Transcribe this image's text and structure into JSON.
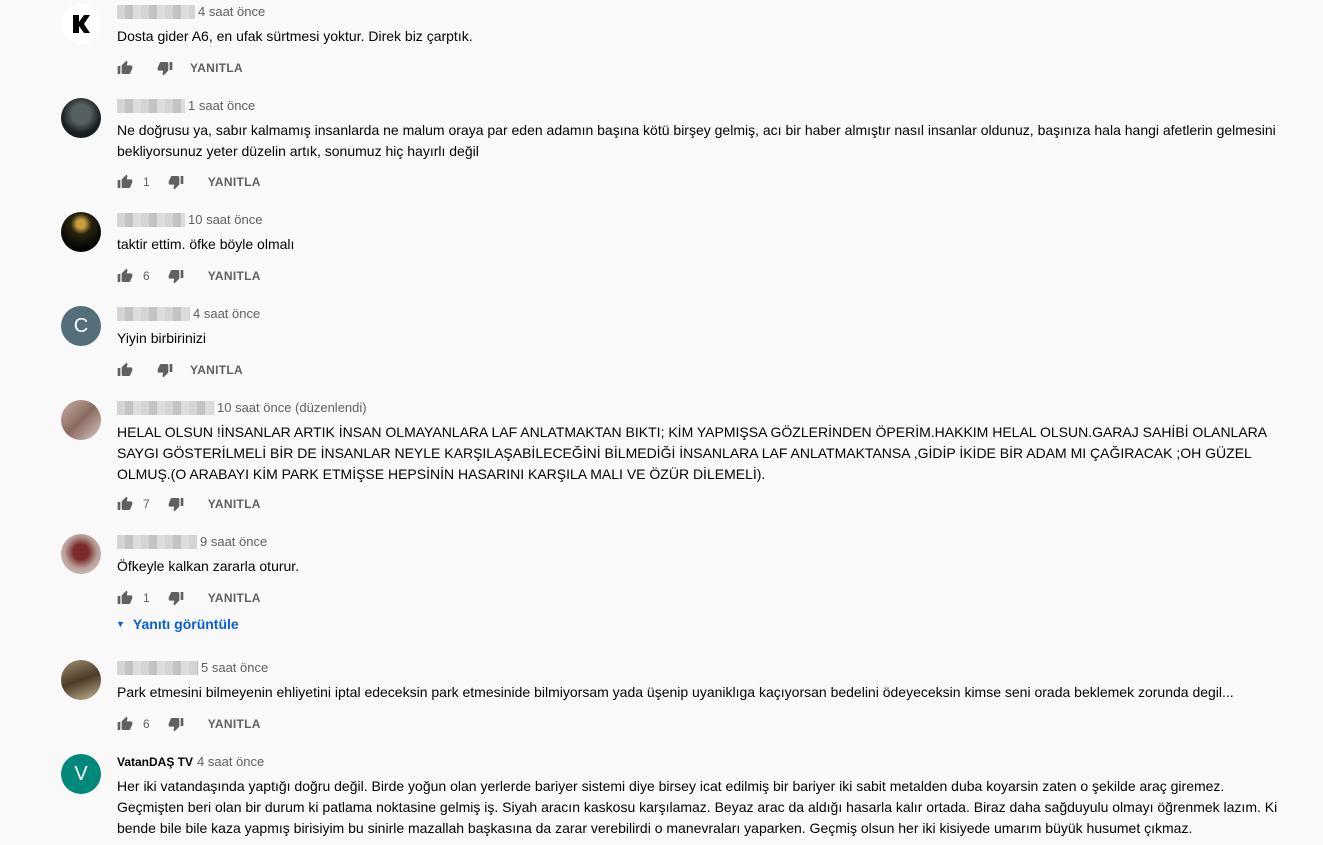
{
  "reply_label": "YANITLA",
  "view_replies_label": "Yanıtı görüntüle",
  "comments": [
    {
      "author": "",
      "time": "4 saat önce",
      "text": "Dosta gider  A6, en ufak sürtmesi yoktur. Direk biz çarptık.",
      "likes": ""
    },
    {
      "author": "",
      "time": "1 saat önce",
      "text": "Ne doğrusu ya, sabır kalmamış insanlarda ne malum oraya par eden adamın başına kötü birşey gelmiş, acı bir haber almıştır nasıl insanlar oldunuz, başınıza hala hangi afetlerin gelmesini bekliyorsunuz yeter düzelin artık, sonumuz hiç hayırlı değil",
      "likes": "1"
    },
    {
      "author": "",
      "time": "10 saat önce",
      "text": "taktir ettim. öfke böyle olmalı",
      "likes": "6"
    },
    {
      "author": "",
      "time": "4 saat önce",
      "text": "Yiyin birbirinizi",
      "likes": "",
      "avatar_letter": "C"
    },
    {
      "author": "",
      "time": "10 saat önce (düzenlendi)",
      "text": "HELAL OLSUN !İNSANLAR ARTIK İNSAN OLMAYANLARA LAF ANLATMAKTAN BIKTI; KİM YAPMIŞSA GÖZLERİNDEN ÖPERİM.HAKKIM HELAL OLSUN.GARAJ SAHİBİ OLANLARA SAYGI GÖSTERİLMELİ BİR DE İNSANLAR NEYLE KARŞILAŞABİLECEĞİNİ BİLMEDİĞİ İNSANLARA LAF ANLATMAKTANSA ,GİDİP İKİDE BİR ADAM MI ÇAĞIRACAK ;OH GÜZEL OLMUŞ.(O ARABAYI KİM PARK ETMİŞSE HEPSİNİN HASARINI KARŞILA MALI VE ÖZÜR DİLEMELİ).",
      "likes": "7"
    },
    {
      "author": "",
      "time": "9 saat önce",
      "text": "Öfkeyle kalkan zararla oturur.",
      "likes": "1"
    },
    {
      "author": "",
      "time": "5 saat önce",
      "text": "Park etmesini bilmeyenin ehliyetini iptal edeceksin park etmesinide bilmiyorsam yada üşenip uyaniklıga kaçıyorsan  bedelini ödeyeceksin kimse seni orada beklemek zorunda degil...",
      "likes": "6"
    },
    {
      "author": "VatanDAŞ TV",
      "time": "4 saat önce",
      "text": "Her iki vatandaşında yaptığı doğru değil. Birde yoğun olan yerlerde bariyer sistemi diye birsey icat edilmiş bir bariyer iki sabit metalden duba koyarsin zaten o şekilde araç giremez. Geçmişten beri olan bir durum ki patlama noktasine gelmiş iş. Siyah aracın kaskosu karşılamaz. Beyaz arac da aldığı hasarla kalır ortada. Biraz daha sağduyulu olmayı öğrenmek lazım. Ki bende bile bile kaza yapmış birisiyim bu sinirle mazallah başkasına da zarar verebilirdi o manevraları yaparken. Geçmiş olsun her iki kisiyede umarım büyük husumet çıkmaz.",
      "likes": "",
      "avatar_letter": "V"
    }
  ]
}
